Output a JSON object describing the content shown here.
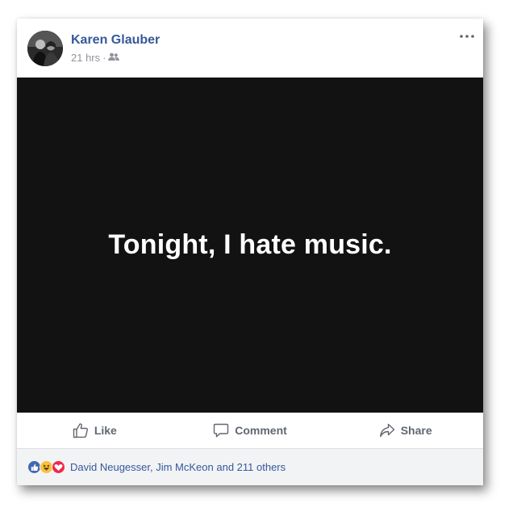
{
  "post": {
    "author": "Karen Glauber",
    "time": "21 hrs",
    "separator": "·",
    "audience_icon": "friends-icon",
    "more_icon": "more-options-icon",
    "content_text": "Tonight, I hate music.",
    "background_color": "#121212"
  },
  "actions": {
    "like_label": "Like",
    "comment_label": "Comment",
    "share_label": "Share"
  },
  "reactions": {
    "icons": [
      "like-reaction-icon",
      "haha-reaction-icon",
      "love-reaction-icon"
    ],
    "summary": "David Neugesser, Jim McKeon and 211 others"
  },
  "colors": {
    "link": "#365899",
    "meta": "#90949c",
    "action": "#606770",
    "footer_bg": "#f2f3f5"
  }
}
